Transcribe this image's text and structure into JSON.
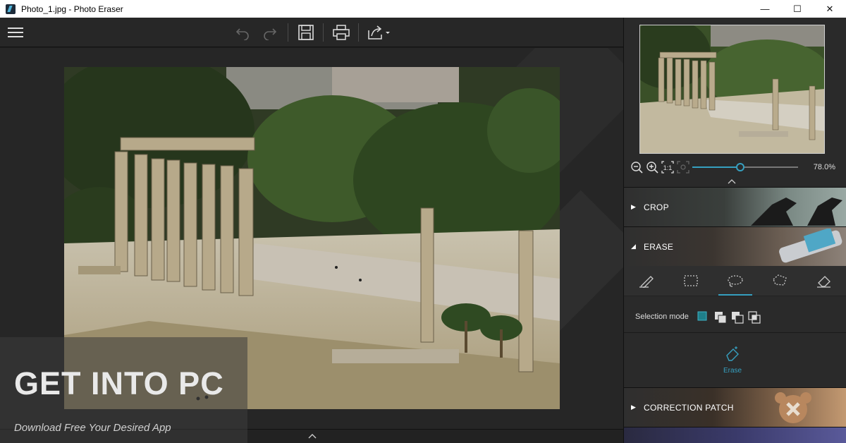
{
  "window": {
    "title": "Photo_1.jpg - Photo Eraser",
    "minimize": "—",
    "maximize": "☐",
    "close": "✕"
  },
  "toolbar": {
    "items": [
      "menu-icon",
      "undo-icon",
      "redo-icon",
      "save-icon",
      "print-icon",
      "share-icon"
    ]
  },
  "navigator": {
    "zoom_value": "78.0%",
    "zoom_level": 0.45
  },
  "panels": {
    "crop": "CROP",
    "erase": "ERASE",
    "correction": "CORRECTION PATCH"
  },
  "erase_tools": [
    "brush-icon",
    "rect-select-icon",
    "lasso-icon",
    "polygon-lasso-icon",
    "eraser-icon"
  ],
  "selection": {
    "label": "Selection mode"
  },
  "erase_button": "Erase",
  "watermark": {
    "title": "GET INTO PC",
    "subtitle": "Download Free Your Desired App"
  },
  "colors": {
    "accent": "#36a0c0",
    "panel": "#2a2a2a",
    "canvas": "#262626"
  }
}
